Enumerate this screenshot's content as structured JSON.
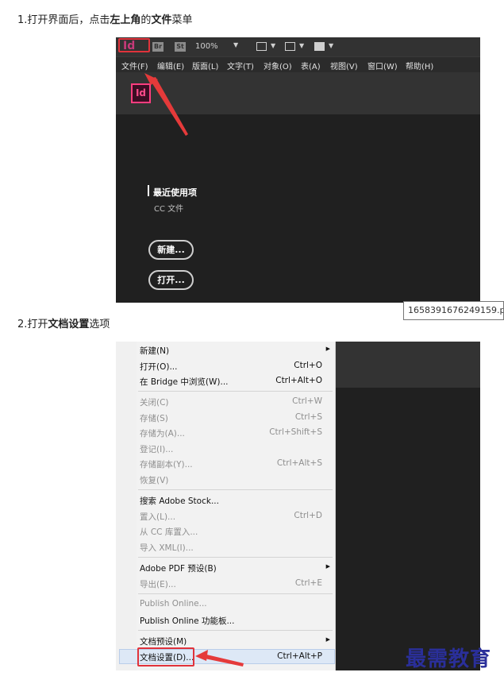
{
  "step1": {
    "prefix": "1.打开界面后，点击",
    "bold1": "左上角",
    "mid": "的",
    "bold2": "文件",
    "suffix": "菜单"
  },
  "step2": {
    "prefix": "2.打开",
    "bold": "文档设置",
    "suffix": "选项"
  },
  "screenshot1": {
    "app_logo": "Id",
    "badges": [
      "Br",
      "St"
    ],
    "zoom": "100%",
    "menus": [
      "文件(F)",
      "编辑(E)",
      "版面(L)",
      "文字(T)",
      "对象(O)",
      "表(A)",
      "视图(V)",
      "窗口(W)",
      "帮助(H)"
    ],
    "home_logo": "Id",
    "recent_heading": "最近使用项",
    "cc_files": "CC 文件",
    "new_button": "新建...",
    "open_button": "打开...",
    "highlight_color": "#e0333b"
  },
  "tooltip": "1658391676249159.p",
  "screenshot2": {
    "menu_items": [
      {
        "label": "新建(N)",
        "shortcut": "",
        "submenu": true,
        "enabled": true
      },
      {
        "label": "打开(O)...",
        "shortcut": "Ctrl+O",
        "submenu": false,
        "enabled": true
      },
      {
        "label": "在 Bridge 中浏览(W)...",
        "shortcut": "Ctrl+Alt+O",
        "submenu": false,
        "enabled": true
      },
      {
        "label": "关闭(C)",
        "shortcut": "Ctrl+W",
        "submenu": false,
        "enabled": false
      },
      {
        "label": "存储(S)",
        "shortcut": "Ctrl+S",
        "submenu": false,
        "enabled": false
      },
      {
        "label": "存储为(A)...",
        "shortcut": "Ctrl+Shift+S",
        "submenu": false,
        "enabled": false
      },
      {
        "label": "登记(I)...",
        "shortcut": "",
        "submenu": false,
        "enabled": false
      },
      {
        "label": "存储副本(Y)...",
        "shortcut": "Ctrl+Alt+S",
        "submenu": false,
        "enabled": false
      },
      {
        "label": "恢复(V)",
        "shortcut": "",
        "submenu": false,
        "enabled": false
      },
      {
        "label": "搜索 Adobe Stock...",
        "shortcut": "",
        "submenu": false,
        "enabled": true
      },
      {
        "label": "置入(L)...",
        "shortcut": "Ctrl+D",
        "submenu": false,
        "enabled": false
      },
      {
        "label": "从 CC 库置入...",
        "shortcut": "",
        "submenu": false,
        "enabled": false
      },
      {
        "label": "导入 XML(I)...",
        "shortcut": "",
        "submenu": false,
        "enabled": false
      },
      {
        "label": "Adobe PDF 预设(B)",
        "shortcut": "",
        "submenu": true,
        "enabled": true
      },
      {
        "label": "导出(E)...",
        "shortcut": "Ctrl+E",
        "submenu": false,
        "enabled": false
      },
      {
        "label": "Publish Online...",
        "shortcut": "",
        "submenu": false,
        "enabled": false
      },
      {
        "label": "Publish Online 功能板...",
        "shortcut": "",
        "submenu": false,
        "enabled": true
      },
      {
        "label": "文档预设(M)",
        "shortcut": "",
        "submenu": true,
        "enabled": true
      },
      {
        "label": "文档设置(D)...",
        "shortcut": "Ctrl+Alt+P",
        "submenu": false,
        "enabled": true
      }
    ],
    "highlight_color": "#e0333b"
  },
  "watermark": "最需教育"
}
